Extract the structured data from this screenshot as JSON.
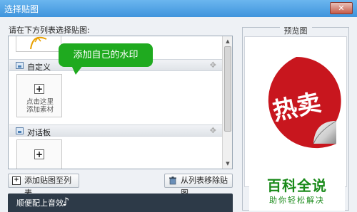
{
  "window": {
    "title": "选择贴图",
    "close_label": "✕"
  },
  "left": {
    "list_label": "请在下方列表选择贴图:",
    "sections": [
      {
        "label": "自定义",
        "add_text_line1": "点击这里",
        "add_text_line2": "添加素材"
      },
      {
        "label": "对话板"
      }
    ],
    "tooltip": "添加自己的水印",
    "add_button": "添加贴图至列表",
    "remove_button": "从列表移除贴图",
    "music_label": "顺便配上音效:"
  },
  "preview": {
    "label": "预览图",
    "sticker_text": "热卖",
    "watermark_main": "百科全说",
    "watermark_sub": "助你轻松解决"
  },
  "colors": {
    "titlebar": "#4a9fe0",
    "tooltip": "#1faa1f",
    "sticker_red": "#c8161e",
    "watermark_green": "#1a8a1a"
  }
}
